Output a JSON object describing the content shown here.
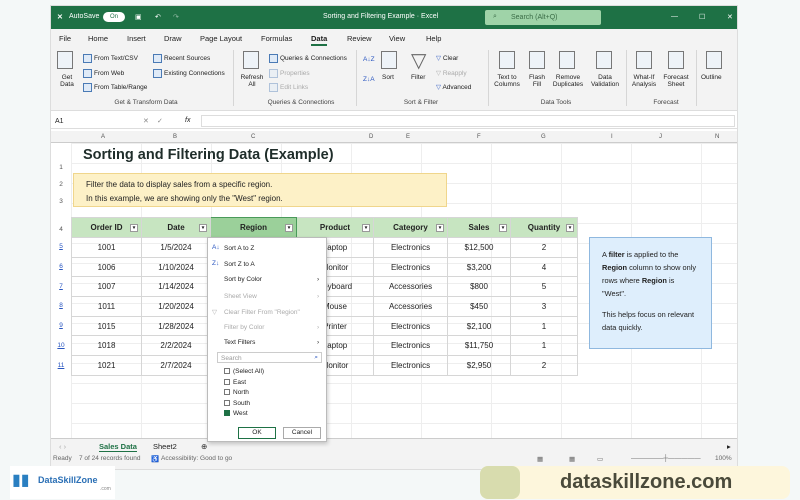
{
  "titlebar": {
    "autosave": "AutoSave",
    "toggle": "On",
    "title": "Sorting and Filtering Example  ·  Excel",
    "search": "Search (Alt+Q)"
  },
  "menu": [
    "File",
    "Home",
    "Insert",
    "Draw",
    "Page Layout",
    "Formulas",
    "Data",
    "Review",
    "View",
    "Help"
  ],
  "ribbon": {
    "get_data": "Get Data",
    "from_text": "From Text/CSV",
    "from_web": "From Web",
    "from_table": "From Table/Range",
    "recent": "Recent Sources",
    "existing": "Existing Connections",
    "group1": "Get & Transform Data",
    "refresh": "Refresh All",
    "queries": "Queries & Connections",
    "properties": "Properties",
    "edit_links": "Edit Links",
    "group2": "Queries & Connections",
    "sort": "Sort",
    "filter": "Filter",
    "clear": "Clear",
    "reapply": "Reapply",
    "advanced": "Advanced",
    "group3": "Sort & Filter",
    "text_to_columns": "Text to Columns",
    "flash_fill": "Flash Fill",
    "remove_dup": "Remove Duplicates",
    "data_validation": "Data Validation",
    "group4": "Data Tools",
    "what_if": "What-If Analysis",
    "forecast_sheet": "Forecast Sheet",
    "group5": "Forecast",
    "outline": "Outline"
  },
  "formula_bar": {
    "name_box": "A1",
    "fx": "fx",
    "value": ""
  },
  "columns": [
    "A",
    "B",
    "C",
    "D",
    "E",
    "F",
    "G",
    "I",
    "J",
    "N"
  ],
  "sheet": {
    "title": "Sorting and Filtering Data (Example)",
    "note1": "Filter the data to display sales from a specific region.",
    "note2": "In this example, we are showing only the \"West\" region.",
    "headers": [
      "Order ID",
      "Date",
      "Region",
      "Product",
      "Category",
      "Sales",
      "Quantity"
    ],
    "rows": [
      {
        "n": "5",
        "c": [
          "1001",
          "1/5/2024",
          "",
          "Laptop",
          "Electronics",
          "$12,500",
          "2"
        ]
      },
      {
        "n": "6",
        "c": [
          "1006",
          "1/10/2024",
          "",
          "Monitor",
          "Electronics",
          "$3,200",
          "4"
        ]
      },
      {
        "n": "7",
        "c": [
          "1007",
          "1/14/2024",
          "",
          "Keyboard",
          "Accessories",
          "$800",
          "5"
        ]
      },
      {
        "n": "8",
        "c": [
          "1011",
          "1/20/2024",
          "",
          "Mouse",
          "Accessories",
          "$450",
          "3"
        ]
      },
      {
        "n": "9",
        "c": [
          "1015",
          "1/28/2024",
          "",
          "Printer",
          "Electronics",
          "$2,100",
          "1"
        ]
      },
      {
        "n": "10",
        "c": [
          "1018",
          "2/2/2024",
          "",
          "Laptop",
          "Electronics",
          "$11,750",
          "1"
        ]
      },
      {
        "n": "11",
        "c": [
          "1021",
          "2/7/2024",
          "",
          "Monitor",
          "Electronics",
          "$2,950",
          "2"
        ]
      }
    ],
    "side_note": {
      "p1a": "A ",
      "p1b": "filter",
      "p1c": " is applied to the ",
      "p1d": "Region",
      "p1e": " column to show only rows where ",
      "p1f": "Region",
      "p1g": " is \"West\".",
      "p2": "This helps focus on relevant data quickly."
    }
  },
  "filter_menu": {
    "sort_az": "Sort A to Z",
    "sort_za": "Sort Z to A",
    "sort_color": "Sort by Color",
    "sheet_view": "Sheet View",
    "clear_filter": "Clear Filter From \"Region\"",
    "filter_color": "Filter by Color",
    "text_filters": "Text Filters",
    "search": "Search",
    "options": [
      {
        "label": "(Select All)",
        "checked": false
      },
      {
        "label": "East",
        "checked": false
      },
      {
        "label": "North",
        "checked": false
      },
      {
        "label": "South",
        "checked": false
      },
      {
        "label": "West",
        "checked": true
      }
    ],
    "ok": "OK",
    "cancel": "Cancel"
  },
  "tabs": [
    "Sales Data",
    "Sheet2"
  ],
  "status": {
    "ready": "Ready",
    "records": "7 of 24 records found",
    "accessibility": "Accessibility: Good to go",
    "zoom": "100%"
  },
  "branding": {
    "logo": "DataSkillZone .com",
    "site": "dataskillzone.com"
  },
  "colors": {
    "excel_green": "#1e7145",
    "header_fill": "#c7e5c1",
    "note_fill": "#fdf1c7",
    "side_fill": "#deeefc"
  }
}
